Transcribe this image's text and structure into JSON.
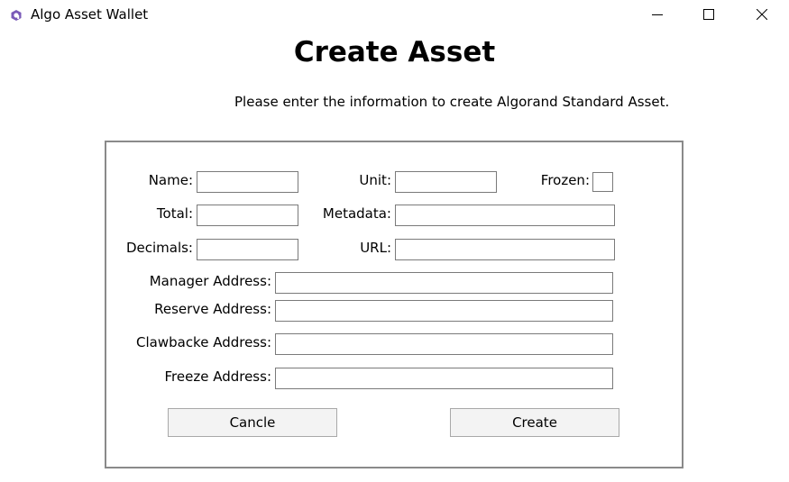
{
  "window": {
    "title": "Algo Asset Wallet",
    "app_icon": "algo-logo-icon",
    "controls": [
      "minimize-icon",
      "maximize-icon",
      "close-icon"
    ]
  },
  "page": {
    "heading": "Create Asset",
    "subheading": "Please enter the information to create Algorand Standard Asset."
  },
  "form": {
    "name_label": "Name:",
    "unit_label": "Unit:",
    "frozen_label": "Frozen:",
    "frozen_checked": false,
    "total_label": "Total:",
    "metadata_label": "Metadata:",
    "decimals_label": "Decimals:",
    "url_label": "URL:",
    "manager_label": "Manager Address:",
    "reserve_label": "Reserve Address:",
    "clawback_label": "Clawbacke Address:",
    "freeze_label": "Freeze Address:",
    "name_value": "",
    "unit_value": "",
    "total_value": "",
    "metadata_value": "",
    "decimals_value": "",
    "url_value": "",
    "manager_value": "",
    "reserve_value": "",
    "clawback_value": "",
    "freeze_value": ""
  },
  "buttons": {
    "cancel_label": "Cancle",
    "create_label": "Create"
  },
  "colors": {
    "accent": "#7a5ab8",
    "border": "#8a8a8a",
    "button_bg": "#f3f3f3"
  }
}
